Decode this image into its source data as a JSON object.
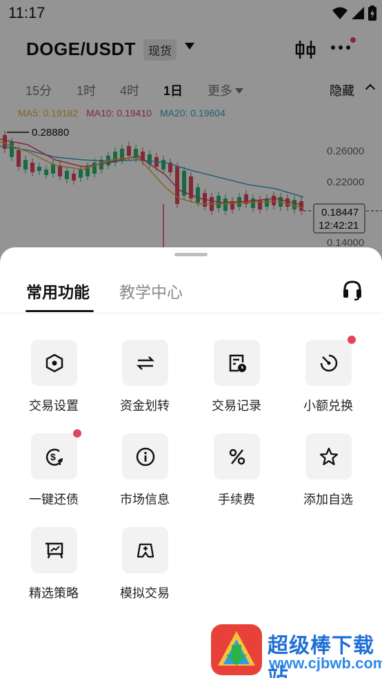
{
  "status_bar": {
    "time": "11:17"
  },
  "header": {
    "pair": "DOGE/USDT",
    "market_type": "现货"
  },
  "intervals": [
    "15分",
    "1时",
    "4时",
    "1日",
    "更多"
  ],
  "active_interval": "1日",
  "hide_label": "隐藏",
  "ma": {
    "ma5": "MA5: 0.19182",
    "ma10": "MA10: 0.19410",
    "ma20": "MA20: 0.19604",
    "colors": {
      "ma5": "#e8a73a",
      "ma10": "#e0455f",
      "ma20": "#3aa6c9"
    }
  },
  "chart_data": {
    "type": "candlestick",
    "y_ticks": [
      "0.26000",
      "0.22000",
      "0.14000"
    ],
    "high_marker": "0.28880",
    "last_price": "0.18447",
    "countdown": "12:42:21",
    "up_color": "#2bb673",
    "down_color": "#e0455f"
  },
  "sheet": {
    "tabs": [
      "常用功能",
      "教学中心"
    ],
    "active_tab": "常用功能",
    "items": [
      {
        "label": "交易设置",
        "icon": "hexagon-settings-icon",
        "badge": false
      },
      {
        "label": "资金划转",
        "icon": "transfer-arrows-icon",
        "badge": false
      },
      {
        "label": "交易记录",
        "icon": "record-clock-icon",
        "badge": false
      },
      {
        "label": "小额兑换",
        "icon": "dial-convert-icon",
        "badge": true
      },
      {
        "label": "一键还债",
        "icon": "dollar-repay-icon",
        "badge": true
      },
      {
        "label": "市场信息",
        "icon": "info-circle-icon",
        "badge": false
      },
      {
        "label": "手续费",
        "icon": "percent-icon",
        "badge": false
      },
      {
        "label": "添加自选",
        "icon": "star-icon",
        "badge": false
      },
      {
        "label": "精选策略",
        "icon": "strategy-chart-icon",
        "badge": false
      },
      {
        "label": "模拟交易",
        "icon": "simulated-trade-icon",
        "badge": false
      }
    ]
  },
  "watermark": {
    "name": "超级棒下载站",
    "url": "www.cjbwb.com"
  }
}
